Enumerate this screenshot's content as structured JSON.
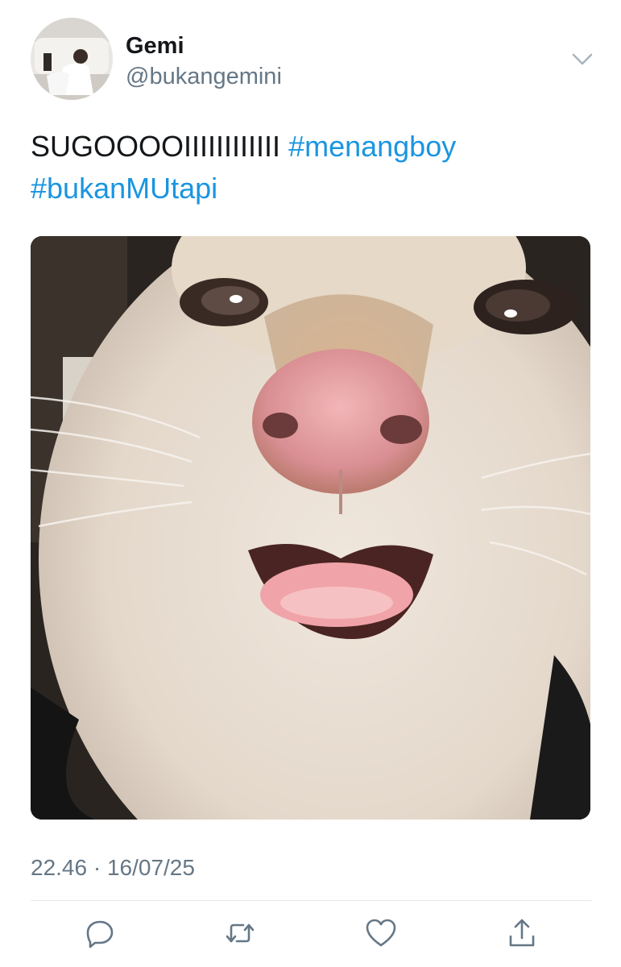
{
  "tweet": {
    "author": {
      "display_name": "Gemi",
      "handle": "@bukangemini"
    },
    "text_plain": "SUGOOOOIIIIIIIIIIII",
    "hashtags": [
      "#menangboy",
      "#bukanMUtapi"
    ],
    "timestamp": "22.46 · 16/07/25"
  },
  "icons": {
    "menu": "chevron-down-icon",
    "reply": "reply-icon",
    "retweet": "retweet-icon",
    "like": "heart-icon",
    "share": "share-icon"
  },
  "colors": {
    "hashtag": "#1b95e0",
    "secondary_text": "#657786",
    "icon": "#657786",
    "divider": "#e1e8ed"
  }
}
